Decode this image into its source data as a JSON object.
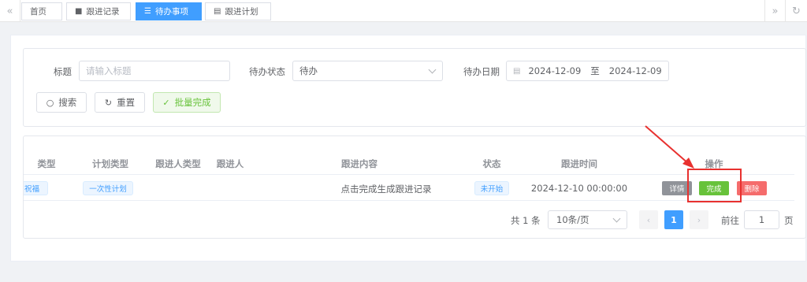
{
  "tabs": {
    "items": [
      {
        "label": "首页"
      },
      {
        "label": "跟进记录"
      },
      {
        "label": "待办事项"
      },
      {
        "label": "跟进计划"
      }
    ]
  },
  "search": {
    "title_label": "标题",
    "title_placeholder": "请输入标题",
    "status_label": "待办状态",
    "status_value": "待办",
    "date_label": "待办日期",
    "date_start": "2024-12-09",
    "date_sep": "至",
    "date_end": "2024-12-09",
    "search_button": "搜索",
    "reset_button": "重置",
    "batch_button": "批量完成"
  },
  "table": {
    "headers": [
      "类型",
      "计划类型",
      "跟进人类型",
      "跟进人",
      "跟进内容",
      "状态",
      "跟进时间",
      "操作"
    ],
    "rows": [
      {
        "type": "祝福",
        "plan_type": "一次性计划",
        "follower_type": "",
        "follower": "",
        "content": "点击完成生成跟进记录",
        "status": "未开始",
        "time": "2024-12-10 00:00:00",
        "actions": {
          "detail": "详情",
          "complete": "完成",
          "delete": "删除"
        }
      }
    ]
  },
  "pagination": {
    "total_text": "共 1 条",
    "page_size": "10条/页",
    "current_page": "1",
    "goto_label": "前往",
    "goto_value": "1",
    "page_unit": "页"
  },
  "colors": {
    "primary": "#409eff",
    "success": "#67c23a",
    "danger": "#f56c6c",
    "info": "#909399",
    "annotation": "#e8312f"
  }
}
